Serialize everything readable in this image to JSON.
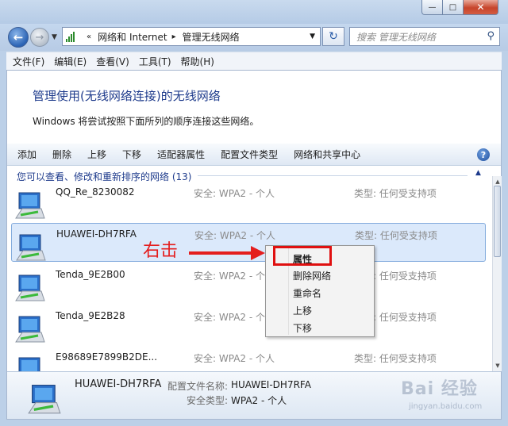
{
  "window": {
    "min": "—",
    "max": "□",
    "close": "✕"
  },
  "nav": {
    "back": "←",
    "forward": "→",
    "breadcrumb_sep": "«",
    "crumbs": [
      "网络和 Internet",
      "管理无线网络"
    ],
    "crumb_arrow": "▸",
    "search_placeholder": "搜索 管理无线网络",
    "refresh": "↻",
    "search_icon": "⚲"
  },
  "menu": [
    "文件(F)",
    "编辑(E)",
    "查看(V)",
    "工具(T)",
    "帮助(H)"
  ],
  "page": {
    "heading": "管理使用(无线网络连接)的无线网络",
    "subtext": "Windows 将尝试按照下面所列的顺序连接这些网络。"
  },
  "toolbar": {
    "items": [
      "添加",
      "删除",
      "上移",
      "下移",
      "适配器属性",
      "配置文件类型",
      "网络和共享中心"
    ],
    "help": "?"
  },
  "group": {
    "header": "您可以查看、修改和重新排序的网络 (13)",
    "collapse": "▲"
  },
  "networks": [
    {
      "name": "QQ_Re_8230082",
      "security": "安全: WPA2 - 个人",
      "type": "类型: 任何受支持项"
    },
    {
      "name": "HUAWEI-DH7RFA",
      "security": "安全: WPA2 - 个人",
      "type": "类型: 任何受支持项"
    },
    {
      "name": "Tenda_9E2B00",
      "security": "安全: WPA2 - 个人",
      "type": "类型: 任何受支持项"
    },
    {
      "name": "Tenda_9E2B28",
      "security": "安全: WPA2 - 个人",
      "type": "类型: 任何受支持项"
    },
    {
      "name": "E98689E7899B2DE...",
      "security": "安全: WPA2 - 个人",
      "type": "类型: 任何受支持项"
    }
  ],
  "scrollbar": {
    "up": "▲",
    "down": "▼"
  },
  "context_menu": [
    "属性",
    "删除网络",
    "重命名",
    "上移",
    "下移"
  ],
  "annotation": {
    "text": "右击"
  },
  "details": {
    "name": "HUAWEI-DH7RFA",
    "profile_label": "配置文件名称:",
    "profile_value": "HUAWEI-DH7RFA",
    "security_label": "安全类型:",
    "security_value": "WPA2 - 个人"
  },
  "watermark": {
    "main": "Bai 经验",
    "sub": "jingyan.baidu.com"
  },
  "colors": {
    "accent": "#1e3b8c",
    "annotation_red": "#e01010",
    "selection": "#dbe9fb"
  }
}
